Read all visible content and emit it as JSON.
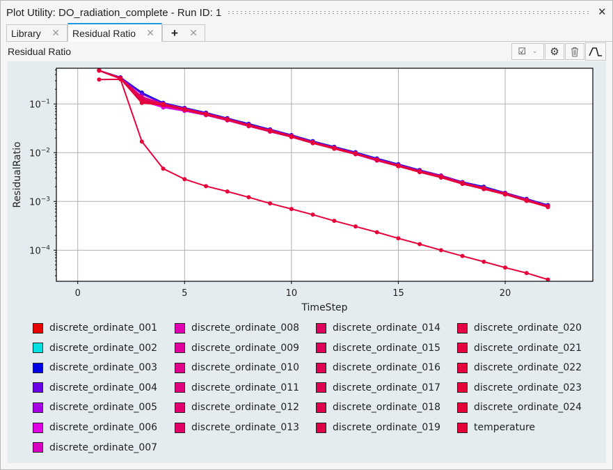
{
  "window": {
    "title": "Plot Utility: DO_radiation_complete - Run ID: 1"
  },
  "tabs": [
    {
      "label": "Library",
      "close": "✕"
    },
    {
      "label": "Residual Ratio",
      "close": "✕",
      "active": true
    },
    {
      "label": "+",
      "close": "✕"
    }
  ],
  "panel": {
    "title": "Residual Ratio"
  },
  "toolbar": {
    "icons": [
      "checkbox-dropdown-icon",
      "gear-icon",
      "trash-icon",
      "step-curve-icon"
    ]
  },
  "chart_data": {
    "type": "line",
    "xlabel": "TimeStep",
    "ylabel": "ResidualRatio",
    "xlim": [
      -1,
      24.1
    ],
    "ylim": [
      2.3e-05,
      0.54
    ],
    "yscale": "log",
    "grid": true,
    "legend": "bottom",
    "x_ticks": [
      {
        "v": 0,
        "label": "0"
      },
      {
        "v": 5,
        "label": "5"
      },
      {
        "v": 10,
        "label": "10"
      },
      {
        "v": 15,
        "label": "15"
      },
      {
        "v": 20,
        "label": "20"
      }
    ],
    "y_ticks": [
      {
        "v": 0.1,
        "base": "10",
        "exp": "−1"
      },
      {
        "v": 0.01,
        "base": "10",
        "exp": "−2"
      },
      {
        "v": 0.001,
        "base": "10",
        "exp": "−3"
      },
      {
        "v": 0.0001,
        "base": "10",
        "exp": "−4"
      }
    ],
    "x": [
      1,
      2,
      3,
      4,
      5,
      6,
      7,
      8,
      9,
      10,
      11,
      12,
      13,
      14,
      15,
      16,
      17,
      18,
      19,
      20,
      21,
      22
    ],
    "series": [
      {
        "name": "discrete_ordinate_001",
        "color": "#e60000",
        "values": [
          0.485,
          0.35,
          0.17,
          0.105,
          0.083,
          0.066,
          0.051,
          0.039,
          0.03,
          0.023,
          0.0172,
          0.0132,
          0.0102,
          0.0076,
          0.0058,
          0.0044,
          0.0034,
          0.0025,
          0.002,
          0.0015,
          0.00113,
          0.00084
        ]
      },
      {
        "name": "discrete_ordinate_002",
        "color": "#00e0e0",
        "values": [
          0.485,
          0.35,
          0.17,
          0.105,
          0.083,
          0.066,
          0.051,
          0.039,
          0.03,
          0.023,
          0.0172,
          0.0132,
          0.0102,
          0.0076,
          0.0058,
          0.0044,
          0.0034,
          0.0025,
          0.002,
          0.0015,
          0.00113,
          0.00084
        ]
      },
      {
        "name": "discrete_ordinate_003",
        "color": "#0000e6",
        "values": [
          0.485,
          0.35,
          0.17,
          0.105,
          0.083,
          0.066,
          0.051,
          0.039,
          0.03,
          0.023,
          0.0172,
          0.0132,
          0.0102,
          0.0076,
          0.0058,
          0.0044,
          0.0034,
          0.0025,
          0.002,
          0.0015,
          0.00113,
          0.00084
        ]
      },
      {
        "name": "discrete_ordinate_004",
        "color": "#6a00e6",
        "values": [
          0.485,
          0.35,
          0.16,
          0.103,
          0.082,
          0.065,
          0.05,
          0.038,
          0.0295,
          0.0227,
          0.0168,
          0.0129,
          0.01,
          0.0074,
          0.0057,
          0.0043,
          0.0034,
          0.0025,
          0.0019,
          0.0015,
          0.00111,
          0.00082
        ]
      },
      {
        "name": "discrete_ordinate_005",
        "color": "#a800e6",
        "values": [
          0.485,
          0.33,
          0.115,
          0.085,
          0.072,
          0.059,
          0.046,
          0.035,
          0.027,
          0.021,
          0.0157,
          0.0121,
          0.0093,
          0.0069,
          0.0053,
          0.004,
          0.0031,
          0.0023,
          0.0018,
          0.0014,
          0.00104,
          0.00077
        ]
      },
      {
        "name": "discrete_ordinate_006",
        "color": "#e000e6",
        "values": [
          0.485,
          0.33,
          0.115,
          0.085,
          0.072,
          0.059,
          0.046,
          0.035,
          0.027,
          0.021,
          0.0157,
          0.0121,
          0.0093,
          0.0069,
          0.0053,
          0.004,
          0.0031,
          0.0023,
          0.0018,
          0.0014,
          0.00104,
          0.00077
        ]
      },
      {
        "name": "discrete_ordinate_007",
        "color": "#d800c0",
        "values": [
          0.485,
          0.33,
          0.12,
          0.09,
          0.074,
          0.06,
          0.047,
          0.036,
          0.0275,
          0.0213,
          0.0159,
          0.0122,
          0.0094,
          0.007,
          0.0054,
          0.0041,
          0.0032,
          0.0023,
          0.0018,
          0.0014,
          0.00105,
          0.00078
        ]
      },
      {
        "name": "discrete_ordinate_008",
        "color": "#e000b0",
        "values": [
          0.485,
          0.34,
          0.13,
          0.1,
          0.079,
          0.063,
          0.049,
          0.037,
          0.0287,
          0.022,
          0.0164,
          0.0126,
          0.0097,
          0.0072,
          0.0055,
          0.0042,
          0.0033,
          0.0024,
          0.0019,
          0.00145,
          0.00108,
          0.0008
        ]
      },
      {
        "name": "discrete_ordinate_009",
        "color": "#e0009c",
        "values": [
          0.485,
          0.34,
          0.13,
          0.1,
          0.079,
          0.063,
          0.049,
          0.037,
          0.0287,
          0.022,
          0.0164,
          0.0126,
          0.0097,
          0.0072,
          0.0055,
          0.0042,
          0.0033,
          0.0024,
          0.0019,
          0.00145,
          0.00108,
          0.0008
        ]
      },
      {
        "name": "discrete_ordinate_010",
        "color": "#e0008c",
        "values": [
          0.485,
          0.34,
          0.13,
          0.1,
          0.079,
          0.063,
          0.049,
          0.037,
          0.0287,
          0.022,
          0.0164,
          0.0126,
          0.0097,
          0.0072,
          0.0055,
          0.0042,
          0.0033,
          0.0024,
          0.0019,
          0.00145,
          0.00108,
          0.0008
        ]
      },
      {
        "name": "discrete_ordinate_011",
        "color": "#e0007c",
        "values": [
          0.485,
          0.34,
          0.14,
          0.1,
          0.079,
          0.063,
          0.049,
          0.037,
          0.0287,
          0.022,
          0.0164,
          0.0126,
          0.0097,
          0.0072,
          0.0055,
          0.0042,
          0.0033,
          0.0024,
          0.0019,
          0.00145,
          0.00108,
          0.0008
        ]
      },
      {
        "name": "discrete_ordinate_012",
        "color": "#e00070",
        "values": [
          0.485,
          0.34,
          0.13,
          0.1,
          0.079,
          0.063,
          0.049,
          0.037,
          0.0287,
          0.022,
          0.0164,
          0.0126,
          0.0097,
          0.0072,
          0.0055,
          0.0042,
          0.0033,
          0.0024,
          0.0019,
          0.00145,
          0.00108,
          0.0008
        ]
      },
      {
        "name": "discrete_ordinate_013",
        "color": "#e00066",
        "values": [
          0.485,
          0.34,
          0.125,
          0.1,
          0.079,
          0.063,
          0.049,
          0.037,
          0.0287,
          0.022,
          0.0164,
          0.0126,
          0.0097,
          0.0072,
          0.0055,
          0.0042,
          0.0033,
          0.0024,
          0.0019,
          0.00145,
          0.00108,
          0.0008
        ]
      },
      {
        "name": "discrete_ordinate_014",
        "color": "#e0005e",
        "values": [
          0.485,
          0.34,
          0.12,
          0.098,
          0.078,
          0.062,
          0.048,
          0.0365,
          0.0283,
          0.0217,
          0.0162,
          0.0124,
          0.0096,
          0.0071,
          0.0054,
          0.0041,
          0.0032,
          0.0024,
          0.0018,
          0.0014,
          0.00106,
          0.00079
        ]
      },
      {
        "name": "discrete_ordinate_015",
        "color": "#e00058",
        "values": [
          0.485,
          0.34,
          0.12,
          0.098,
          0.078,
          0.062,
          0.048,
          0.0365,
          0.0283,
          0.0217,
          0.0162,
          0.0124,
          0.0096,
          0.0071,
          0.0054,
          0.0041,
          0.0032,
          0.0024,
          0.0018,
          0.0014,
          0.00106,
          0.00079
        ]
      },
      {
        "name": "discrete_ordinate_016",
        "color": "#e00054",
        "values": [
          0.485,
          0.34,
          0.12,
          0.098,
          0.078,
          0.062,
          0.048,
          0.0365,
          0.0283,
          0.0217,
          0.0162,
          0.0124,
          0.0096,
          0.0071,
          0.0054,
          0.0041,
          0.0032,
          0.0024,
          0.0018,
          0.0014,
          0.00106,
          0.00079
        ]
      },
      {
        "name": "discrete_ordinate_017",
        "color": "#e00050",
        "values": [
          0.485,
          0.34,
          0.12,
          0.098,
          0.078,
          0.062,
          0.048,
          0.0365,
          0.0283,
          0.0217,
          0.0162,
          0.0124,
          0.0096,
          0.0071,
          0.0054,
          0.0041,
          0.0032,
          0.0024,
          0.0018,
          0.0014,
          0.00106,
          0.00079
        ]
      },
      {
        "name": "discrete_ordinate_018",
        "color": "#e0004c",
        "values": [
          0.485,
          0.34,
          0.12,
          0.098,
          0.078,
          0.062,
          0.048,
          0.0365,
          0.0283,
          0.0217,
          0.0162,
          0.0124,
          0.0096,
          0.0071,
          0.0054,
          0.0041,
          0.0032,
          0.0024,
          0.0018,
          0.0014,
          0.00106,
          0.00079
        ]
      },
      {
        "name": "discrete_ordinate_019",
        "color": "#e00048",
        "values": [
          0.485,
          0.34,
          0.12,
          0.098,
          0.078,
          0.062,
          0.048,
          0.0365,
          0.0283,
          0.0217,
          0.0162,
          0.0124,
          0.0096,
          0.0071,
          0.0054,
          0.0041,
          0.0032,
          0.0024,
          0.0018,
          0.0014,
          0.00106,
          0.00079
        ]
      },
      {
        "name": "discrete_ordinate_020",
        "color": "#e60044",
        "values": [
          0.485,
          0.33,
          0.11,
          0.095,
          0.076,
          0.06,
          0.047,
          0.0355,
          0.0275,
          0.0211,
          0.0158,
          0.0121,
          0.0094,
          0.007,
          0.0053,
          0.004,
          0.0031,
          0.0023,
          0.0018,
          0.0014,
          0.00103,
          0.00077
        ]
      },
      {
        "name": "discrete_ordinate_021",
        "color": "#e60040",
        "values": [
          0.485,
          0.33,
          0.11,
          0.095,
          0.076,
          0.06,
          0.047,
          0.0355,
          0.0275,
          0.0211,
          0.0158,
          0.0121,
          0.0094,
          0.007,
          0.0053,
          0.004,
          0.0031,
          0.0023,
          0.0018,
          0.0014,
          0.00103,
          0.00077
        ]
      },
      {
        "name": "discrete_ordinate_022",
        "color": "#e6003e",
        "values": [
          0.485,
          0.33,
          0.105,
          0.095,
          0.076,
          0.06,
          0.047,
          0.0355,
          0.0275,
          0.0211,
          0.0158,
          0.0121,
          0.0094,
          0.007,
          0.0053,
          0.004,
          0.0031,
          0.0023,
          0.0018,
          0.0014,
          0.00103,
          0.00077
        ]
      },
      {
        "name": "discrete_ordinate_023",
        "color": "#e6003c",
        "values": [
          0.485,
          0.33,
          0.105,
          0.095,
          0.076,
          0.06,
          0.047,
          0.0355,
          0.0275,
          0.0211,
          0.0158,
          0.0121,
          0.0094,
          0.007,
          0.0053,
          0.004,
          0.0031,
          0.0023,
          0.0018,
          0.0014,
          0.00103,
          0.00077
        ]
      },
      {
        "name": "discrete_ordinate_024",
        "color": "#e6003a",
        "values": [
          0.485,
          0.33,
          0.11,
          0.095,
          0.076,
          0.06,
          0.047,
          0.0355,
          0.0275,
          0.0211,
          0.0158,
          0.0121,
          0.0094,
          0.007,
          0.0053,
          0.004,
          0.0031,
          0.0023,
          0.0018,
          0.0014,
          0.00103,
          0.00077
        ]
      },
      {
        "name": "temperature",
        "color": "#e6003a",
        "values": [
          0.316,
          0.32,
          0.0169,
          0.0047,
          0.00286,
          0.00206,
          0.0016,
          0.00122,
          0.00091,
          0.0007,
          0.000536,
          0.0004,
          0.000306,
          0.000234,
          0.000175,
          0.000133,
          0.0001,
          7.6e-05,
          5.8e-05,
          4.4e-05,
          3.4e-05,
          2.5e-05
        ]
      }
    ]
  }
}
